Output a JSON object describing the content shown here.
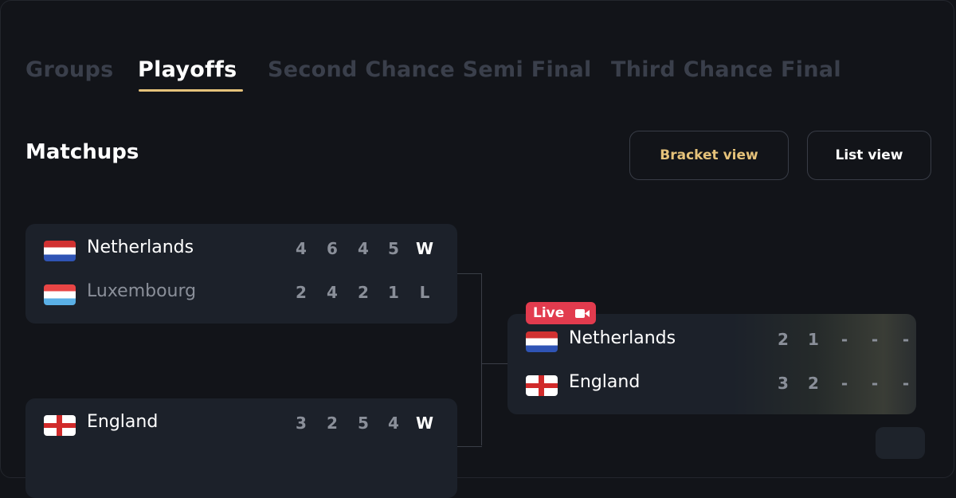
{
  "tabs": [
    {
      "label": "Groups",
      "active": false
    },
    {
      "label": "Playoffs",
      "active": true
    },
    {
      "label": "Second Chance Semi Final",
      "active": false
    },
    {
      "label": "Third Chance Final",
      "active": false
    }
  ],
  "section": {
    "title": "Matchups"
  },
  "view_buttons": {
    "bracket": "Bracket view",
    "list": "List view"
  },
  "colors": {
    "accent": "#e5c27a",
    "live": "#e23b4e",
    "background": "#121419",
    "card": "#1c212a"
  },
  "matches": [
    {
      "teams": [
        {
          "name": "Netherlands",
          "flag": "netherlands-flag",
          "scores": [
            "4",
            "6",
            "4",
            "5"
          ],
          "result": "W"
        },
        {
          "name": "Luxembourg",
          "flag": "luxembourg-flag",
          "scores": [
            "2",
            "4",
            "2",
            "1"
          ],
          "result": "L"
        }
      ]
    },
    {
      "teams": [
        {
          "name": "England",
          "flag": "england-flag",
          "scores": [
            "3",
            "2",
            "5",
            "4"
          ],
          "result": "W"
        }
      ]
    },
    {
      "live_label": "Live",
      "live_icon": "video-camera-icon",
      "teams": [
        {
          "name": "Netherlands",
          "flag": "netherlands-flag",
          "scores": [
            "2",
            "1",
            "-",
            "-",
            "-"
          ]
        },
        {
          "name": "England",
          "flag": "england-flag",
          "scores": [
            "3",
            "2",
            "-",
            "-",
            "-"
          ]
        }
      ]
    }
  ]
}
